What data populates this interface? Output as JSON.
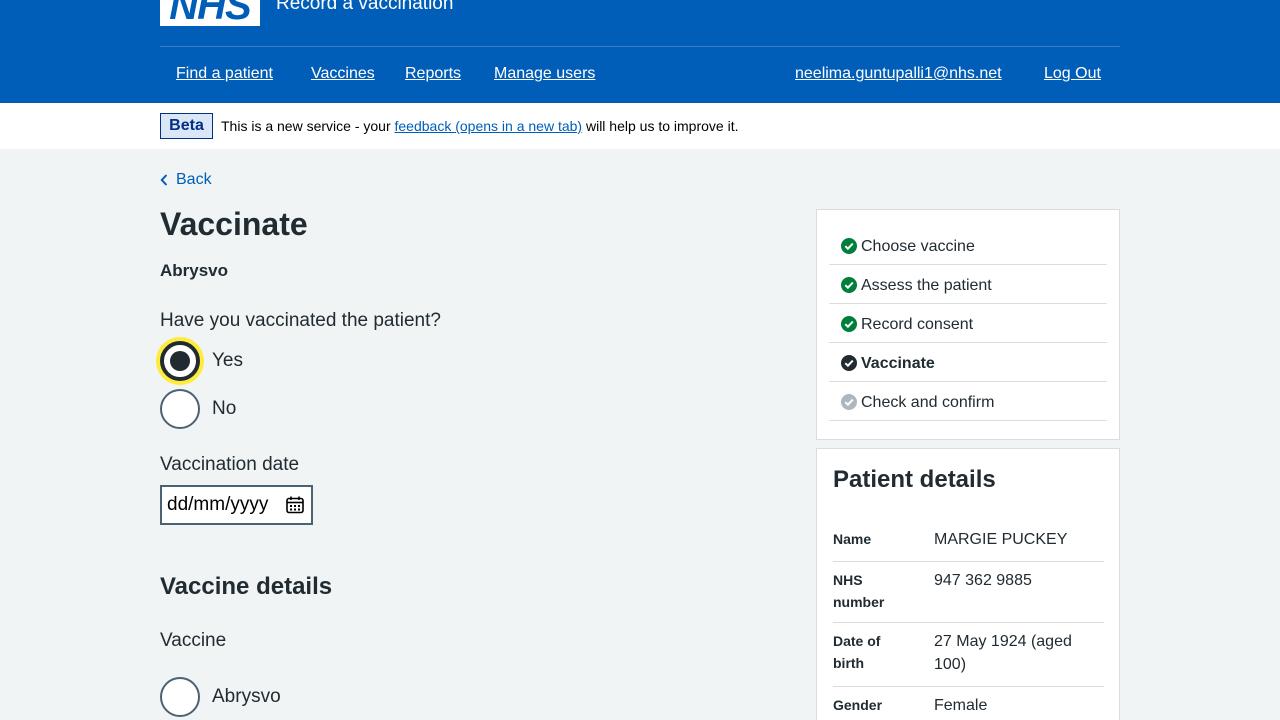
{
  "header": {
    "logo_text": "NHS",
    "service_name": "Record a vaccination",
    "nav": [
      {
        "label": "Find a patient"
      },
      {
        "label": "Vaccines"
      },
      {
        "label": "Reports"
      },
      {
        "label": "Manage users"
      }
    ],
    "user_email": "neelima.guntupalli1@nhs.net",
    "logout_label": "Log Out"
  },
  "beta": {
    "tag": "Beta",
    "text_before": "This is a new service - your ",
    "link_text": "feedback (opens in a new tab)",
    "text_after": " will help us to improve it."
  },
  "back_label": "Back",
  "page_title": "Vaccinate",
  "vaccine_name": "Abrysvo",
  "vaccinated_question": {
    "label": "Have you vaccinated the patient?",
    "options": [
      {
        "label": "Yes",
        "selected": true
      },
      {
        "label": "No",
        "selected": false
      }
    ]
  },
  "vaccination_date": {
    "label": "Vaccination date",
    "placeholder": "dd/mm/yyyy",
    "value": "dd/mm/yyyy"
  },
  "vaccine_details": {
    "heading": "Vaccine details",
    "vaccine_label": "Vaccine",
    "options": [
      {
        "label": "Abrysvo",
        "selected": false
      }
    ]
  },
  "task_list": [
    {
      "label": "Choose vaccine",
      "status": "complete"
    },
    {
      "label": "Assess the patient",
      "status": "complete"
    },
    {
      "label": "Record consent",
      "status": "complete"
    },
    {
      "label": "Vaccinate",
      "status": "current"
    },
    {
      "label": "Check and confirm",
      "status": "pending"
    }
  ],
  "patient_details": {
    "heading": "Patient details",
    "rows": [
      {
        "key": "Name",
        "value": "MARGIE PUCKEY"
      },
      {
        "key": "NHS number",
        "value": "947 362 9885"
      },
      {
        "key": "Date of birth",
        "value": "27 May 1924 (aged 100)"
      },
      {
        "key": "Gender",
        "value": "Female"
      }
    ]
  },
  "colors": {
    "nhs_blue": "#005eb8",
    "complete_green": "#007f3b",
    "focus_yellow": "#ffeb3b",
    "text": "#212b32"
  },
  "icons": [
    "chevron-left-icon",
    "calendar-icon",
    "check-circle-icon"
  ]
}
